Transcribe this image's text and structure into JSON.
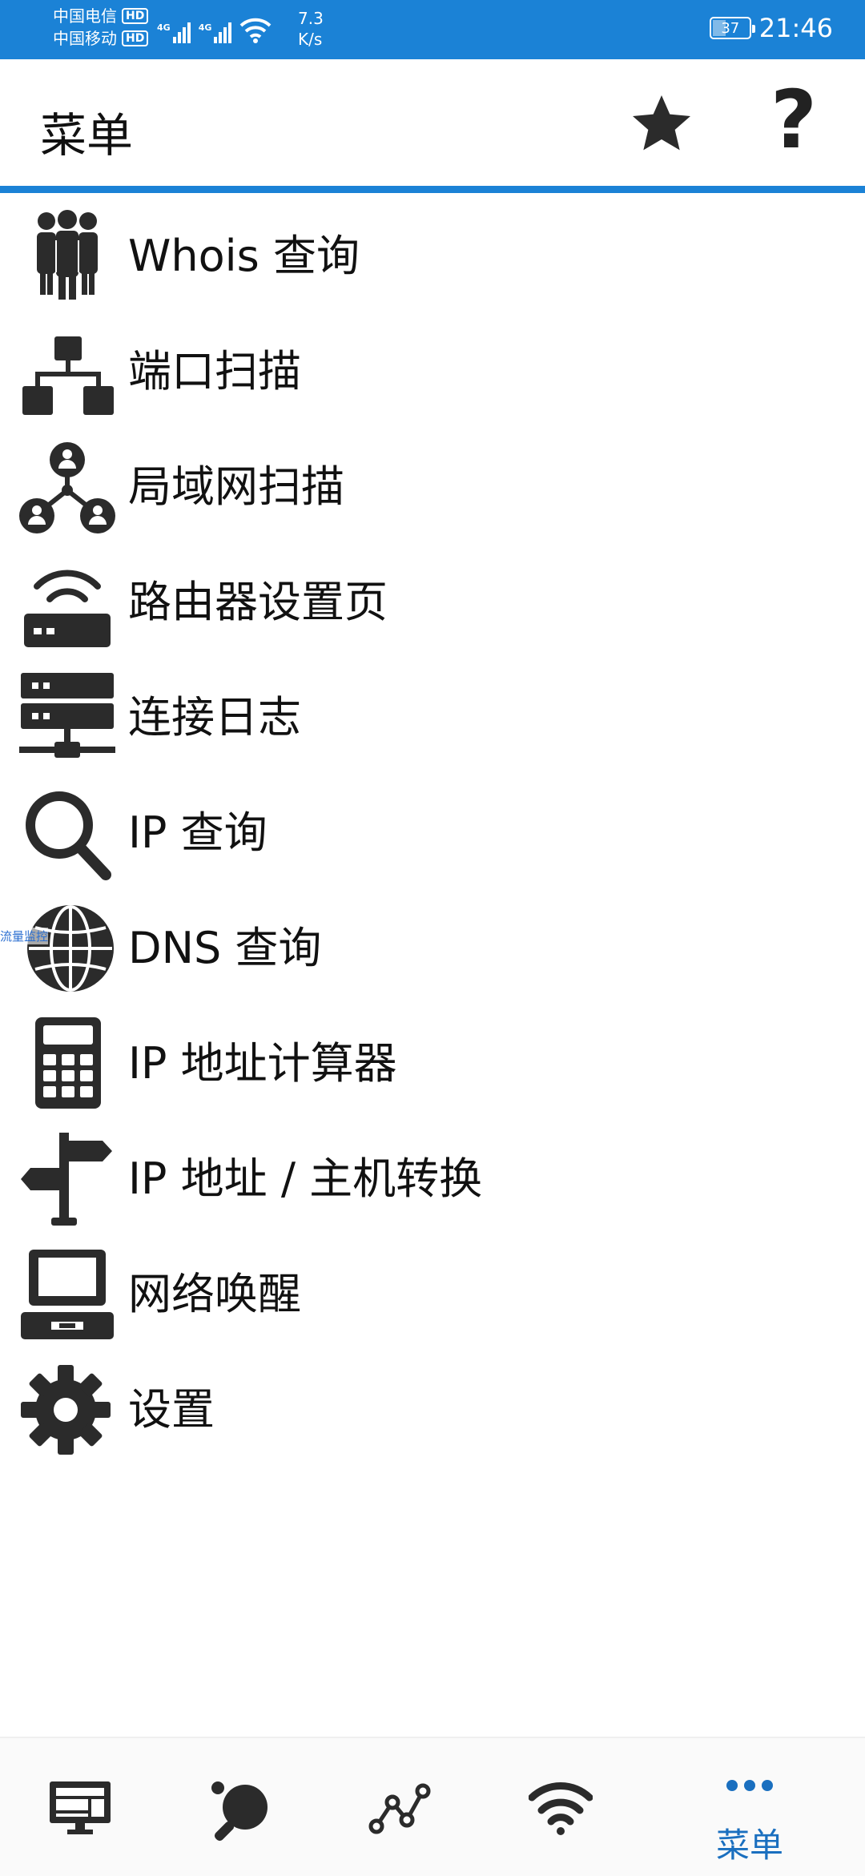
{
  "status_bar": {
    "carrier1": "中国电信",
    "carrier2": "中国移动",
    "hd": "HD",
    "net1": "4G",
    "net2": "4G",
    "speed_value": "7.3",
    "speed_unit": "K/s",
    "battery": "37",
    "time": "21:46"
  },
  "header": {
    "title": "菜单",
    "help": "?",
    "star_icon": "star-icon"
  },
  "menu": [
    {
      "label": "Whois 查询",
      "icon": "people-group-icon"
    },
    {
      "label": "端口扫描",
      "icon": "sitemap-icon"
    },
    {
      "label": "局域网扫描",
      "icon": "network-users-icon"
    },
    {
      "label": "路由器设置页",
      "icon": "router-icon"
    },
    {
      "label": "连接日志",
      "icon": "server-icon"
    },
    {
      "label": "IP 查询",
      "icon": "magnifier-icon"
    },
    {
      "label": "DNS 查询",
      "icon": "globe-icon"
    },
    {
      "label": "IP 地址计算器",
      "icon": "calculator-icon"
    },
    {
      "label": "IP 地址 / 主机转换",
      "icon": "signpost-icon"
    },
    {
      "label": "网络唤醒",
      "icon": "desktop-computer-icon"
    },
    {
      "label": "设置",
      "icon": "gear-icon"
    }
  ],
  "floating_tag": "流量监控",
  "bottom_nav": {
    "active_label": "菜单",
    "items": [
      "monitor-icon",
      "ping-pong-icon",
      "graph-nodes-icon",
      "wifi-icon",
      "more-dots-icon"
    ]
  },
  "colors": {
    "accent": "#1b82d6",
    "icon": "#2b2b2b",
    "nav_active": "#1a6fbf"
  }
}
